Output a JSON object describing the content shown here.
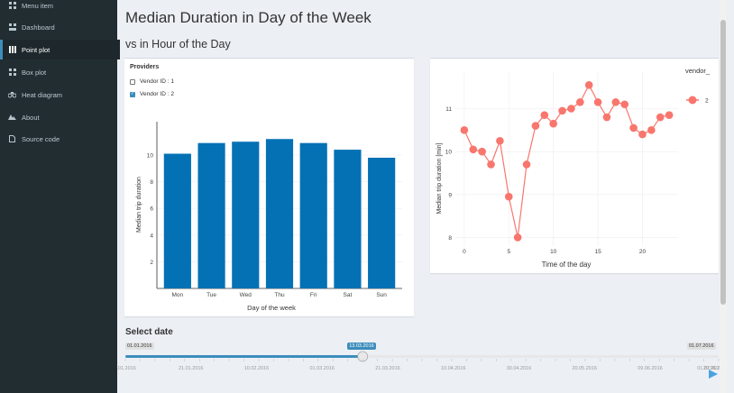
{
  "sidebar": {
    "items": [
      {
        "label": "Menu item",
        "icon": "grid-icon",
        "active": false
      },
      {
        "label": "Dashboard",
        "icon": "dashboard-icon",
        "active": false
      },
      {
        "label": "Point plot",
        "icon": "grid-icon",
        "active": true
      },
      {
        "label": "Box plot",
        "icon": "grid-icon",
        "active": false
      },
      {
        "label": "Heat diagram",
        "icon": "heat-icon",
        "active": false
      },
      {
        "label": "About",
        "icon": "about-icon",
        "active": false
      },
      {
        "label": "Source code",
        "icon": "file-icon",
        "active": false
      }
    ]
  },
  "header": {
    "title": "Median Duration in Day of the Week",
    "subtitle": "vs in Hour of the Day"
  },
  "providers": {
    "title": "Providers",
    "options": [
      {
        "label": "Vendor ID : 1",
        "checked": false
      },
      {
        "label": "Vendor ID : 2",
        "checked": true
      }
    ]
  },
  "chart_data": [
    {
      "type": "bar",
      "categories": [
        "Mon",
        "Tue",
        "Wed",
        "Thu",
        "Fri",
        "Sat",
        "Sun"
      ],
      "values": [
        10.1,
        10.9,
        11.0,
        11.2,
        10.9,
        10.4,
        9.8
      ],
      "xlabel": "Day of the week",
      "ylabel": "Median trip duration",
      "ylim": [
        0,
        12.5
      ],
      "yticks": [
        2,
        4,
        6,
        8,
        10
      ],
      "color": "#0571b5"
    },
    {
      "type": "line",
      "x": [
        0,
        1,
        2,
        3,
        4,
        5,
        6,
        7,
        8,
        9,
        10,
        11,
        12,
        13,
        14,
        15,
        16,
        17,
        18,
        19,
        20,
        21,
        22,
        23
      ],
      "series": [
        {
          "name": "2",
          "values": [
            10.5,
            10.05,
            10.0,
            9.7,
            10.25,
            8.95,
            8.0,
            9.7,
            10.6,
            10.85,
            10.65,
            10.95,
            11.0,
            11.15,
            11.55,
            11.15,
            10.8,
            11.15,
            11.1,
            10.55,
            10.4,
            10.5,
            10.8,
            10.85
          ],
          "color": "#f8766d"
        }
      ],
      "legend_title": "vendor_",
      "xlabel": "Time of the day",
      "ylabel": "Median trip duration [min]",
      "xlim": [
        -1,
        24
      ],
      "ylim": [
        7.8,
        11.85
      ],
      "xticks": [
        0,
        5,
        10,
        15,
        20
      ],
      "yticks": [
        8,
        9,
        10,
        11
      ],
      "legend_position": "top-right"
    }
  ],
  "date_slider": {
    "title": "Select date",
    "min_label": "01.01.2016",
    "max_label": "01.07.2016",
    "value_label": "13.03.2016",
    "value_fraction": 0.4,
    "ticks": [
      "01.01.2016",
      "21.01.2016",
      "10.02.2016",
      "01.03.2016",
      "21.03.2016",
      "10.04.2016",
      "30.04.2016",
      "20.05.2016",
      "09.06.2016",
      "29.06.2016",
      "01.07.2016"
    ],
    "accent": "#3c8dbc"
  }
}
